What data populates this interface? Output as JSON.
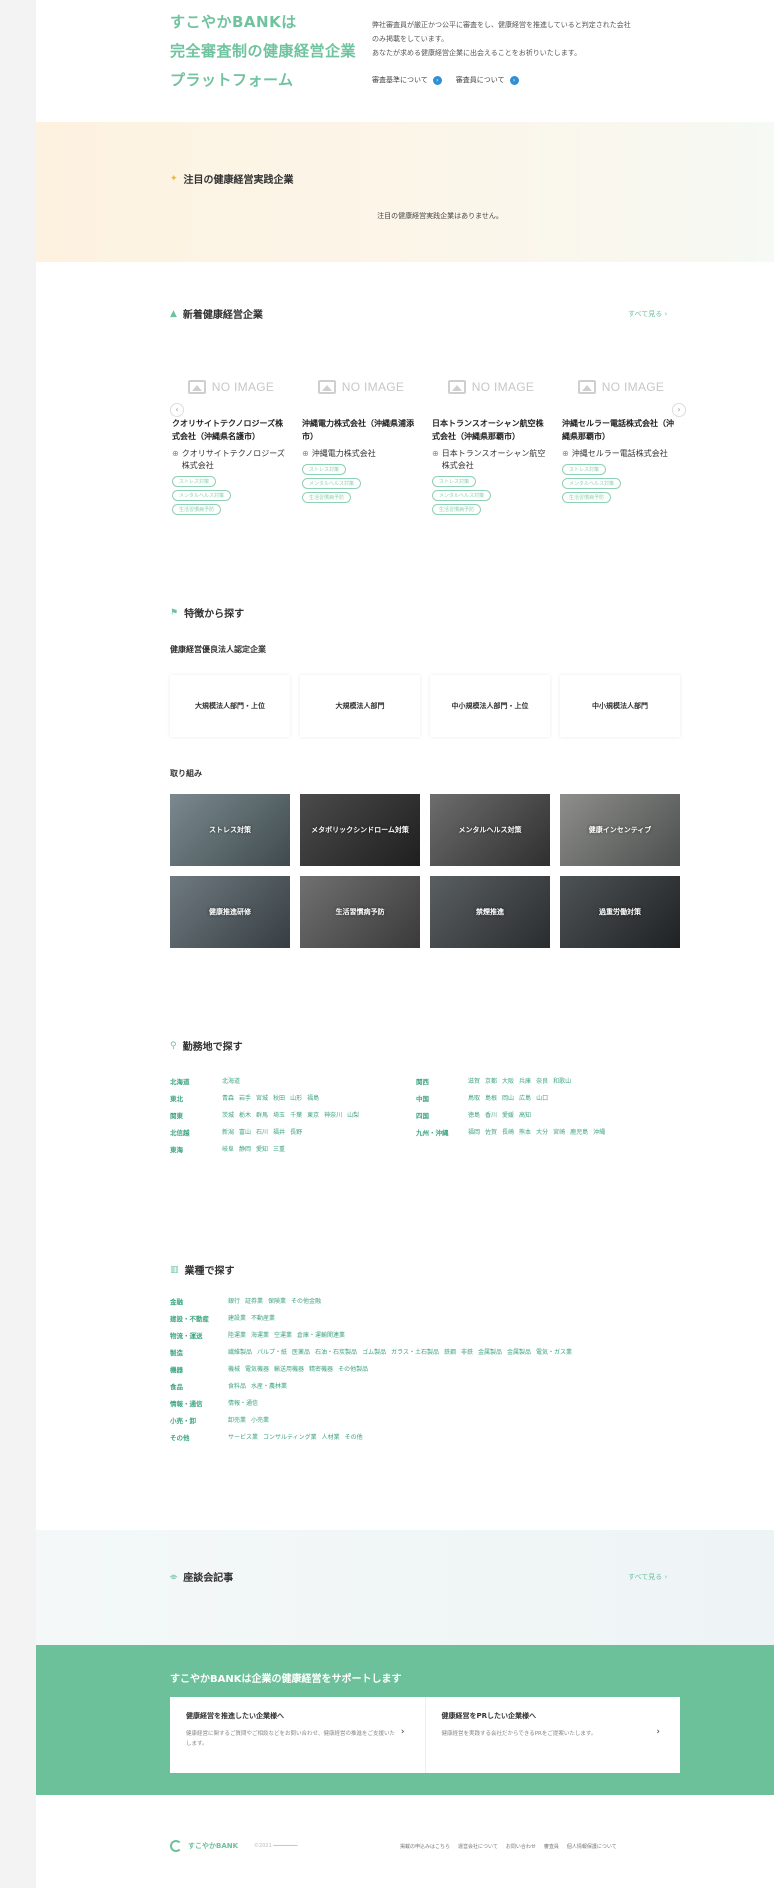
{
  "hero": {
    "title_lines": [
      "すこやかBANKは",
      "完全審査制の健康経営企業",
      "プラットフォーム"
    ],
    "description_lines": [
      "弊社審査員が厳正かつ公平に審査をし、健康経営を推進していると判定された会社",
      "のみ掲載をしています。",
      "あなたが求める健康経営企業に出会えることをお祈りいたします。"
    ],
    "link_criteria": "審査基準について",
    "link_reviewers": "審査員について"
  },
  "featured": {
    "heading": "注目の健康経営実践企業",
    "empty_message": "注目の健康経営実践企業はありません。"
  },
  "new_companies": {
    "heading": "新着健康経営企業",
    "see_all": "すべて見る ›",
    "no_image": "NO IMAGE",
    "cards": [
      {
        "name": "クオリサイトテクノロジーズ株式会社（沖縄県名護市）",
        "company": "クオリサイトテクノロジーズ株式会社",
        "tags": [
          "ストレス対策",
          "メンタルヘルス対策",
          "生活習慣病予防"
        ]
      },
      {
        "name": "沖縄電力株式会社（沖縄県浦添市）",
        "company": "沖縄電力株式会社",
        "tags": [
          "ストレス対策",
          "メンタルヘルス対策",
          "生活習慣病予防"
        ]
      },
      {
        "name": "日本トランスオーシャン航空株式会社（沖縄県那覇市）",
        "company": "日本トランスオーシャン航空株式会社",
        "tags": [
          "ストレス対策",
          "メンタルヘルス対策",
          "生活習慣病予防"
        ]
      },
      {
        "name": "沖縄セルラー電話株式会社（沖縄県那覇市）",
        "company": "沖縄セルラー電話株式会社",
        "tags": [
          "ストレス対策",
          "メンタルヘルス対策",
          "生活習慣病予防"
        ]
      }
    ]
  },
  "features": {
    "heading": "特徴から探す",
    "cert_heading": "健康経営優良法人認定企業",
    "certs": [
      "大規模法人部門・上位",
      "大規模法人部門",
      "中小規模法人部門・上位",
      "中小規模法人部門"
    ],
    "initiatives_heading": "取り組み",
    "initiatives": [
      "ストレス対策",
      "メタボリックシンドローム対策",
      "メンタルヘルス対策",
      "健康インセンティブ",
      "健康推進研修",
      "生活習慣病予防",
      "禁煙推進",
      "過重労働対策"
    ]
  },
  "regions": {
    "heading": "勤務地で探す",
    "left": [
      {
        "area": "北海道",
        "prefs": [
          "北海道"
        ]
      },
      {
        "area": "東北",
        "prefs": [
          "青森",
          "岩手",
          "宮城",
          "秋田",
          "山形",
          "福島"
        ]
      },
      {
        "area": "関東",
        "prefs": [
          "茨城",
          "栃木",
          "群馬",
          "埼玉",
          "千葉",
          "東京",
          "神奈川",
          "山梨"
        ]
      },
      {
        "area": "北信越",
        "prefs": [
          "新潟",
          "富山",
          "石川",
          "福井",
          "長野"
        ]
      },
      {
        "area": "東海",
        "prefs": [
          "岐阜",
          "静岡",
          "愛知",
          "三重"
        ]
      }
    ],
    "right": [
      {
        "area": "関西",
        "prefs": [
          "滋賀",
          "京都",
          "大阪",
          "兵庫",
          "奈良",
          "和歌山"
        ]
      },
      {
        "area": "中国",
        "prefs": [
          "鳥取",
          "島根",
          "岡山",
          "広島",
          "山口"
        ]
      },
      {
        "area": "四国",
        "prefs": [
          "徳島",
          "香川",
          "愛媛",
          "高知"
        ]
      },
      {
        "area": "九州・沖縄",
        "prefs": [
          "福岡",
          "佐賀",
          "長崎",
          "熊本",
          "大分",
          "宮崎",
          "鹿児島",
          "沖縄"
        ]
      }
    ]
  },
  "industries": {
    "heading": "業種で探す",
    "rows": [
      {
        "cat": "金融",
        "items": [
          "銀行",
          "証券業",
          "保険業",
          "その他金融"
        ]
      },
      {
        "cat": "建設・不動産",
        "items": [
          "建設業",
          "不動産業"
        ]
      },
      {
        "cat": "物流・運送",
        "items": [
          "陸運業",
          "海運業",
          "空運業",
          "倉庫・運輸関連業"
        ]
      },
      {
        "cat": "製造",
        "items": [
          "繊維製品",
          "パルプ・紙",
          "医薬品",
          "石油・石炭製品",
          "ゴム製品",
          "ガラス・土石製品",
          "鉄鋼",
          "非鉄",
          "金属製品",
          "金属製品",
          "電気・ガス業"
        ]
      },
      {
        "cat": "機器",
        "items": [
          "機械",
          "電気機器",
          "輸送用機器",
          "精密機器",
          "その他製品"
        ]
      },
      {
        "cat": "食品",
        "items": [
          "食料品",
          "水産・農林業"
        ]
      },
      {
        "cat": "情報・通信",
        "items": [
          "情報・通信"
        ]
      },
      {
        "cat": "小売・卸",
        "items": [
          "卸売業",
          "小売業"
        ]
      },
      {
        "cat": "その他",
        "items": [
          "サービス業",
          "コンサルティング業",
          "人材業",
          "その他"
        ]
      }
    ]
  },
  "talk": {
    "heading": "座談会記事",
    "see_all": "すべて見る ›"
  },
  "support": {
    "title": "すこやかBANKは企業の健康経営をサポートします",
    "left_title": "健康経営を推進したい企業様へ",
    "left_desc": "健康経営に関するご質問やご相談などをお問い合わせ、健康経営の推進をご支援いたします。",
    "right_title": "健康経営をPRしたい企業様へ",
    "right_desc": "健康経営を実践する会社だからできるPRをご提案いたします。",
    "arrow": "›"
  },
  "footer": {
    "logo": "すこやかBANK",
    "copyright": "©2021 ━━━━━━━━",
    "links": [
      "掲載の申込みはこちら",
      "運営会社について",
      "お問い合わせ",
      "審査員",
      "個人情報保護について"
    ]
  },
  "colors": {
    "accent": "#6fc39f",
    "green_band": "#6cc19a",
    "link_blue": "#2f8fd6"
  }
}
